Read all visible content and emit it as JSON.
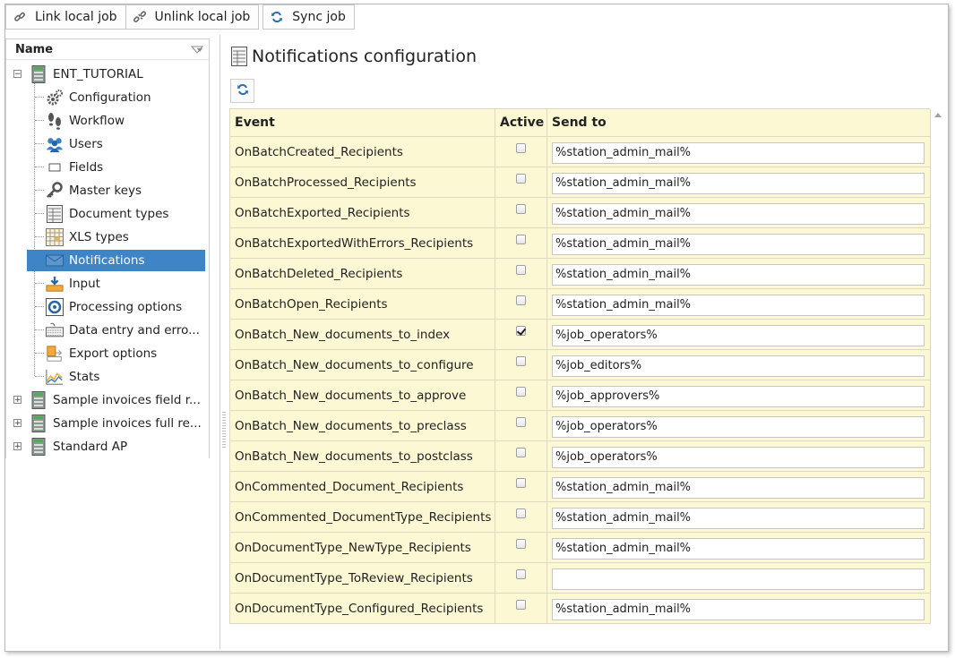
{
  "toolbar": {
    "link_label": "Link local job",
    "unlink_label": "Unlink local job",
    "sync_label": "Sync job"
  },
  "tree": {
    "header": "Name",
    "root": "ENT_TUTORIAL",
    "children": [
      {
        "label": "Configuration",
        "icon": "gears-icon"
      },
      {
        "label": "Workflow",
        "icon": "footprints-icon"
      },
      {
        "label": "Users",
        "icon": "users-icon"
      },
      {
        "label": "Fields",
        "icon": "field-icon"
      },
      {
        "label": "Master keys",
        "icon": "key-icon"
      },
      {
        "label": "Document types",
        "icon": "document-types-icon"
      },
      {
        "label": "XLS types",
        "icon": "spreadsheet-icon"
      },
      {
        "label": "Notifications",
        "icon": "notifications-icon",
        "selected": true
      },
      {
        "label": "Input",
        "icon": "input-icon"
      },
      {
        "label": "Processing options",
        "icon": "processing-icon"
      },
      {
        "label": "Data entry and erro...",
        "icon": "keyboard-icon"
      },
      {
        "label": "Export options",
        "icon": "export-icon"
      },
      {
        "label": "Stats",
        "icon": "stats-icon"
      }
    ],
    "siblings": [
      "Sample invoices field r...",
      "Sample invoices full re...",
      "Standard AP"
    ]
  },
  "page": {
    "title": "Notifications configuration"
  },
  "grid": {
    "headers": {
      "event": "Event",
      "active": "Active",
      "send_to": "Send to"
    },
    "rows": [
      {
        "event": "OnBatchCreated_Recipients",
        "active": false,
        "send_to": "%station_admin_mail%"
      },
      {
        "event": "OnBatchProcessed_Recipients",
        "active": false,
        "send_to": "%station_admin_mail%"
      },
      {
        "event": "OnBatchExported_Recipients",
        "active": false,
        "send_to": "%station_admin_mail%"
      },
      {
        "event": "OnBatchExportedWithErrors_Recipients",
        "active": false,
        "send_to": "%station_admin_mail%"
      },
      {
        "event": "OnBatchDeleted_Recipients",
        "active": false,
        "send_to": "%station_admin_mail%"
      },
      {
        "event": "OnBatchOpen_Recipients",
        "active": false,
        "send_to": "%station_admin_mail%"
      },
      {
        "event": "OnBatch_New_documents_to_index",
        "active": true,
        "send_to": "%job_operators%"
      },
      {
        "event": "OnBatch_New_documents_to_configure",
        "active": false,
        "send_to": "%job_editors%"
      },
      {
        "event": "OnBatch_New_documents_to_approve",
        "active": false,
        "send_to": "%job_approvers%"
      },
      {
        "event": "OnBatch_New_documents_to_preclass",
        "active": false,
        "send_to": "%job_operators%"
      },
      {
        "event": "OnBatch_New_documents_to_postclass",
        "active": false,
        "send_to": "%job_operators%"
      },
      {
        "event": "OnCommented_Document_Recipients",
        "active": false,
        "send_to": "%station_admin_mail%"
      },
      {
        "event": "OnCommented_DocumentType_Recipients",
        "active": false,
        "send_to": "%station_admin_mail%"
      },
      {
        "event": "OnDocumentType_NewType_Recipients",
        "active": false,
        "send_to": "%station_admin_mail%"
      },
      {
        "event": "OnDocumentType_ToReview_Recipients",
        "active": false,
        "send_to": ""
      },
      {
        "event": "OnDocumentType_Configured_Recipients",
        "active": false,
        "send_to": "%station_admin_mail%"
      }
    ]
  },
  "colors": {
    "selection": "#3d85c6",
    "grid_bg": "#fcf8d4",
    "grid_border": "#dcd9c0"
  }
}
